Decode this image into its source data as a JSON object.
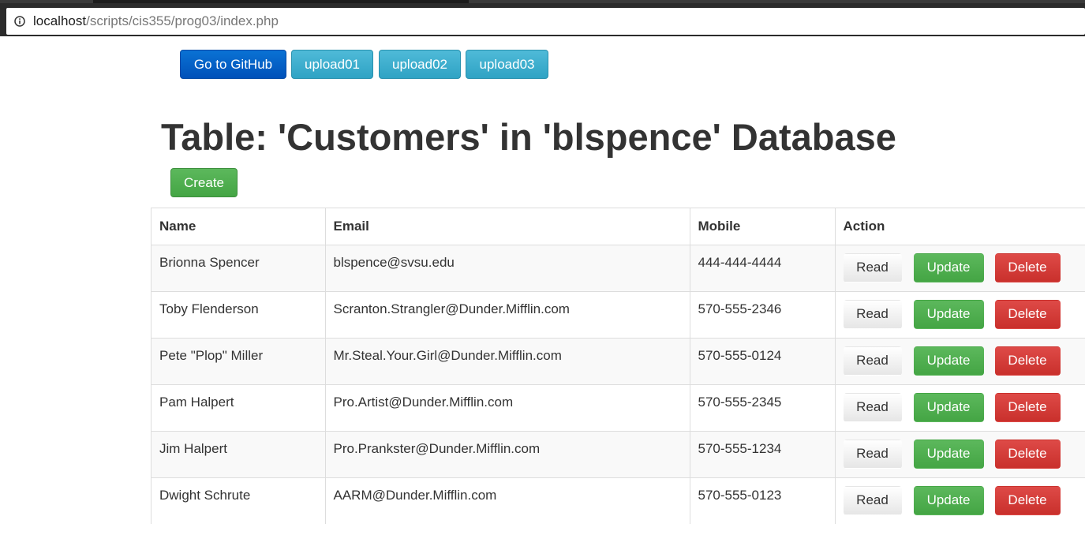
{
  "browser": {
    "url_host": "localhost",
    "url_path": "/scripts/cis355/prog03/index.php"
  },
  "nav": {
    "github": "Go to GitHub",
    "upload01": "upload01",
    "upload02": "upload02",
    "upload03": "upload03"
  },
  "page_title": "Table: 'Customers' in 'blspence' Database",
  "create_label": "Create",
  "table": {
    "headers": [
      "Name",
      "Email",
      "Mobile",
      "Action"
    ],
    "rows": [
      {
        "name": "Brionna Spencer",
        "email": "blspence@svsu.edu",
        "mobile": "444-444-4444"
      },
      {
        "name": "Toby Flenderson",
        "email": "Scranton.Strangler@Dunder.Mifflin.com",
        "mobile": "570-555-2346"
      },
      {
        "name": "Pete \"Plop\" Miller",
        "email": "Mr.Steal.Your.Girl@Dunder.Mifflin.com",
        "mobile": "570-555-0124"
      },
      {
        "name": "Pam Halpert",
        "email": "Pro.Artist@Dunder.Mifflin.com",
        "mobile": "570-555-2345"
      },
      {
        "name": "Jim Halpert",
        "email": "Pro.Prankster@Dunder.Mifflin.com",
        "mobile": "570-555-1234"
      },
      {
        "name": "Dwight Schrute",
        "email": "AARM@Dunder.Mifflin.com",
        "mobile": "570-555-0123"
      }
    ],
    "actions": {
      "read": "Read",
      "update": "Update",
      "delete": "Delete"
    }
  },
  "icons": {
    "address_info": "info-icon"
  },
  "colors": {
    "primary": "#0051b9",
    "info": "#31a5c7",
    "success": "#5cb85c",
    "danger": "#d9534f"
  }
}
